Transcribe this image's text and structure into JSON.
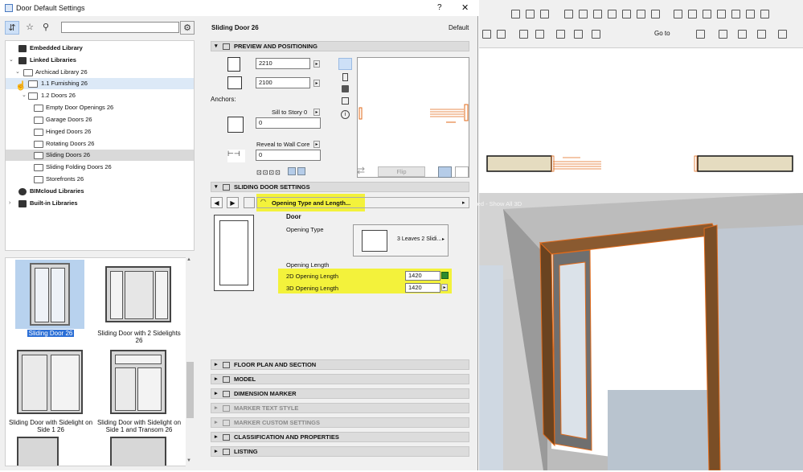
{
  "dialog": {
    "title": "Door Default Settings",
    "help": "?",
    "close": "✕"
  },
  "left": {
    "tree": [
      {
        "label": "Embedded Library",
        "level": 0,
        "arrow": "",
        "bold": true,
        "icon": "library-icon"
      },
      {
        "label": "Linked Libraries",
        "level": 0,
        "arrow": "⌄",
        "bold": true,
        "icon": "library-icon"
      },
      {
        "label": "Archicad Library 26",
        "level": 1,
        "arrow": "⌄",
        "icon": "folder-icon"
      },
      {
        "label": "1.1 Furnishing 26",
        "level": 2,
        "arrow": "",
        "icon": "folder-icon",
        "state": "hover"
      },
      {
        "label": "1.2 Doors 26",
        "level": 2,
        "arrow": "⌄",
        "icon": "folder-icon"
      },
      {
        "label": "Empty Door Openings 26",
        "level": 3,
        "icon": "folder-icon"
      },
      {
        "label": "Garage Doors 26",
        "level": 3,
        "icon": "folder-icon"
      },
      {
        "label": "Hinged Doors 26",
        "level": 3,
        "icon": "folder-icon"
      },
      {
        "label": "Rotating Doors 26",
        "level": 3,
        "icon": "folder-icon"
      },
      {
        "label": "Sliding Doors 26",
        "level": 3,
        "icon": "folder-icon",
        "state": "selected"
      },
      {
        "label": "Sliding Folding Doors 26",
        "level": 3,
        "icon": "folder-icon"
      },
      {
        "label": "Storefronts 26",
        "level": 3,
        "icon": "folder-icon"
      },
      {
        "label": "BIMcloud Libraries",
        "level": 0,
        "arrow": "",
        "bold": true,
        "icon": "library-icon"
      },
      {
        "label": "Built-in Libraries",
        "level": 0,
        "arrow": "›",
        "bold": true,
        "icon": "library-icon"
      }
    ],
    "gallery": [
      {
        "caption": "Sliding Door 26",
        "selected": true
      },
      {
        "caption": "Sliding Door with 2 Sidelights 26"
      },
      {
        "caption": "Sliding Door with Sidelight on Side 1 26"
      },
      {
        "caption": "Sliding Door with Sidelight on Side 1 and Transom 26"
      }
    ]
  },
  "right": {
    "object_name": "Sliding Door 26",
    "default_label": "Default",
    "sections": {
      "preview": "PREVIEW AND POSITIONING",
      "settings": "SLIDING DOOR SETTINGS",
      "floor": "FLOOR PLAN AND SECTION",
      "model": "MODEL",
      "dimension": "DIMENSION MARKER",
      "marker_text": "MARKER TEXT STYLE",
      "marker_custom": "MARKER CUSTOM SETTINGS",
      "classification": "CLASSIFICATION AND PROPERTIES",
      "listing": "LISTING"
    },
    "width": "2210",
    "height": "2100",
    "anchors_label": "Anchors:",
    "sill_label": "Sill to Story 0",
    "sill_value": "0",
    "reveal_label": "Reveal to Wall Core",
    "reveal_value": "0",
    "flip_label": "Flip",
    "page_selector": "Opening Type and Length...",
    "door_label": "Door",
    "opening_type_label": "Opening Type",
    "opening_type_value": "3 Leaves 2 Slidi...",
    "opening_length_label": "Opening Length",
    "length2d_label": "2D Opening Length",
    "length2d_value": "1420",
    "length3d_label": "3D Opening Length",
    "length3d_value": "1420"
  },
  "canvas": {
    "goto_label": "Go to",
    "view3d_caption": "led - Show All 3D"
  },
  "colors": {
    "highlight": "#f3f23b",
    "selection": "#2b6fd6",
    "door_orange": "#e06a1a",
    "wall_fill": "#e5dcc0"
  }
}
